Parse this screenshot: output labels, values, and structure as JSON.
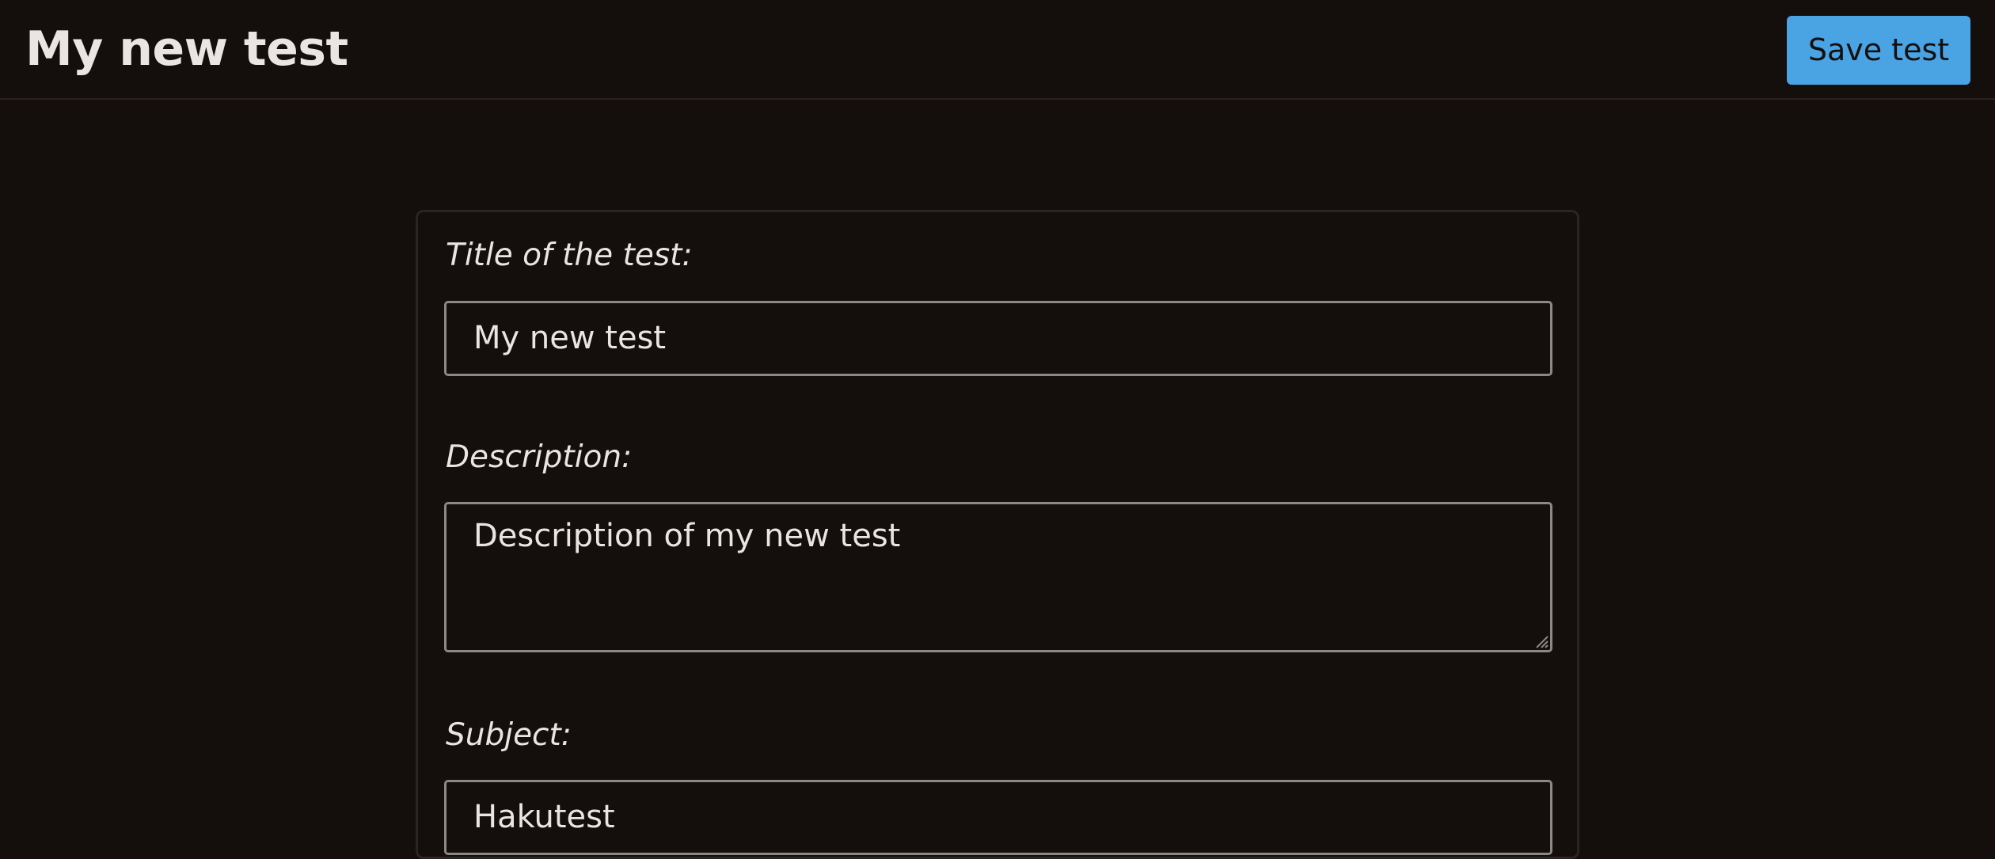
{
  "header": {
    "title": "My new test",
    "save_label": "Save test"
  },
  "form": {
    "title_label": "Title of the test:",
    "title_value": "My new test",
    "description_label": "Description:",
    "description_value": "Description of my new test",
    "subject_label": "Subject:",
    "subject_value": "Hakutest"
  },
  "colors": {
    "background": "#140e0c",
    "accent": "#4aa3e3",
    "text": "#e9e5e2",
    "field_border": "#8c8886"
  }
}
